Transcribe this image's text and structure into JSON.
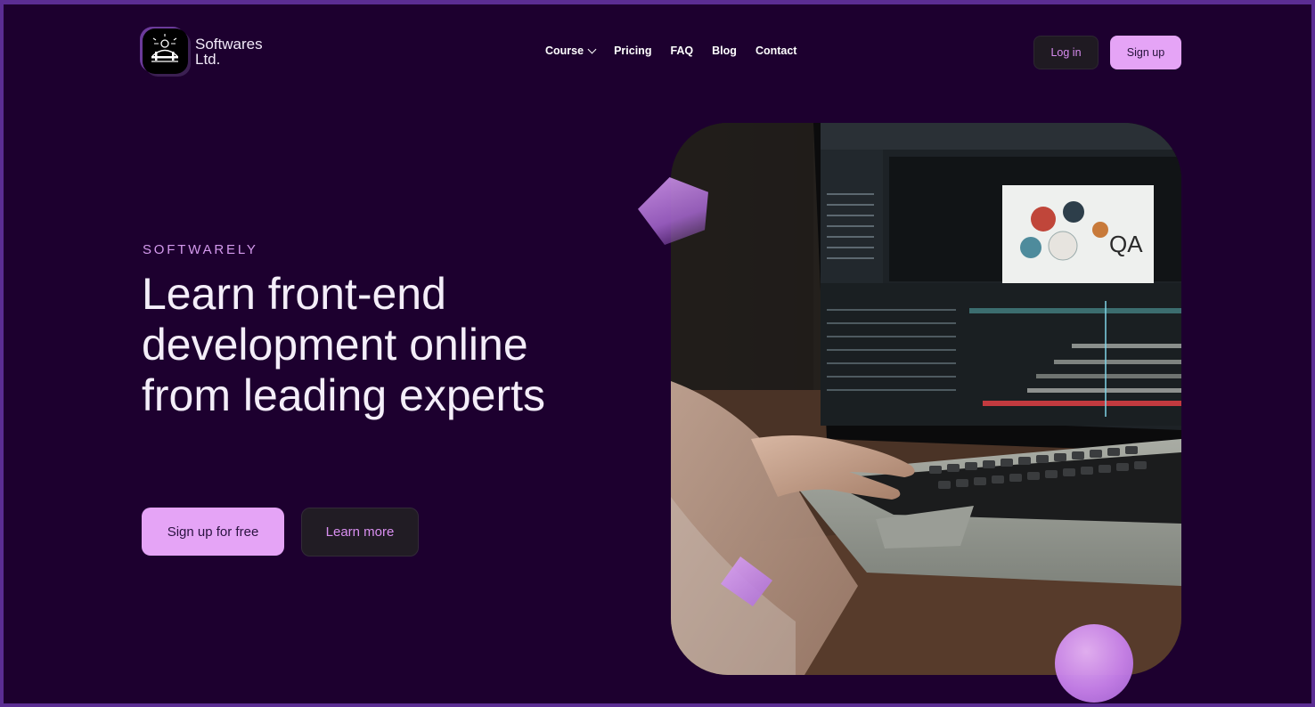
{
  "brand": {
    "name_line1": "Softwares",
    "name_line2": "Ltd.",
    "logo_icon": "bridge-logo-icon"
  },
  "nav": {
    "items": [
      {
        "label": "Course",
        "has_dropdown": true
      },
      {
        "label": "Pricing"
      },
      {
        "label": "FAQ"
      },
      {
        "label": "Blog"
      },
      {
        "label": "Contact"
      }
    ]
  },
  "header_actions": {
    "login_label": "Log in",
    "signup_label": "Sign up"
  },
  "hero": {
    "eyebrow": "SOFTWARELY",
    "headline": "Learn front-end development online from leading experts",
    "primary_cta": "Sign up for free",
    "secondary_cta": "Learn more",
    "image_subject": "laptop-video-editing-photo"
  },
  "colors": {
    "background": "#1d002f",
    "frame_border": "#5b2d93",
    "accent": "#e5a4f6",
    "accent_text": "#d98ff0",
    "dark_button": "#211c24"
  }
}
